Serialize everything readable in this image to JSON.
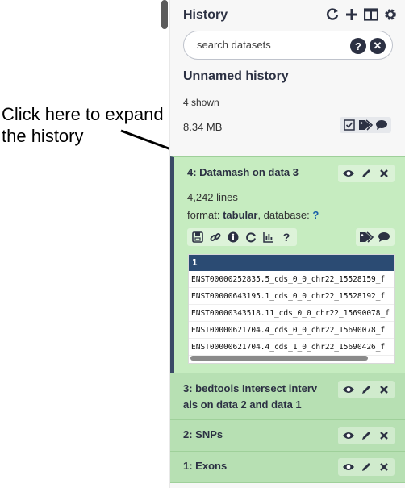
{
  "annotation": {
    "text_line1": "Click here to expand",
    "text_line2": "the history"
  },
  "history": {
    "title": "History",
    "icons": [
      "refresh-icon",
      "plus-icon",
      "columns-icon",
      "gear-icon"
    ],
    "search": {
      "placeholder": "search datasets",
      "value": ""
    },
    "name": "Unnamed history",
    "shown": "4 shown",
    "size": "8.34 MB"
  },
  "datasets": [
    {
      "title": "4: Datamash on data 3",
      "lines": "4,242 lines",
      "format_label": "format:",
      "format": "tabular",
      "database_label": ", database:",
      "database": "?",
      "peek_header": "1",
      "peek_rows": [
        "ENST00000252835.5_cds_0_0_chr22_15528159_f",
        "ENST00000643195.1_cds_0_0_chr22_15528192_f",
        "ENST00000343518.11_cds_0_0_chr22_15690078_f",
        "ENST00000621704.4_cds_0_0_chr22_15690078_f",
        "ENST00000621704.4_cds_1_0_chr22_15690426_f"
      ]
    },
    {
      "title": "3: bedtools Intersect interv als on data 2 and data 1",
      "title_line1": "3: bedtools Intersect interv",
      "title_line2": "als on data 2 and data 1"
    },
    {
      "title": "2: SNPs"
    },
    {
      "title": "1: Exons"
    }
  ],
  "colors": {
    "ok_state": "#b7e0b3",
    "expanded_state": "#c6ecc0",
    "peek_header": "#2b4b73",
    "text": "#2c3143"
  }
}
